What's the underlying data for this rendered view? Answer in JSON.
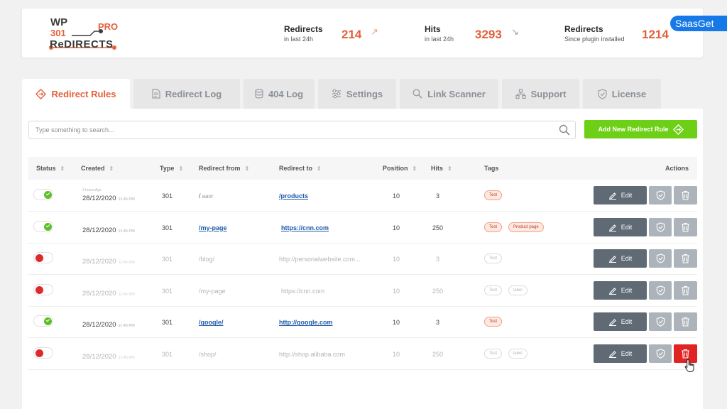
{
  "logo": {
    "wp": "WP",
    "num": "301",
    "pro": "PRO",
    "redirects": "ReDIRECTS"
  },
  "stats": [
    {
      "title": "Redirects",
      "sub": "in last 24h",
      "value": "214",
      "arrow": "↗"
    },
    {
      "title": "Hits",
      "sub": "in last 24h",
      "value": "3293",
      "arrow": "↘"
    },
    {
      "title": "Redirects",
      "sub": "Since plugin installed",
      "value": "1214",
      "arrow": ""
    }
  ],
  "badge": "SaasGet",
  "tabs": [
    {
      "label": "Redirect Rules",
      "icon": "redirect-icon"
    },
    {
      "label": "Redirect Log",
      "icon": "document-icon"
    },
    {
      "label": "404 Log",
      "icon": "database-icon"
    },
    {
      "label": "Settings",
      "icon": "sliders-icon"
    },
    {
      "label": "Link Scanner",
      "icon": "search-icon"
    },
    {
      "label": "Support",
      "icon": "support-icon"
    },
    {
      "label": "License",
      "icon": "shield-icon"
    }
  ],
  "search": {
    "placeholder": "Type something to search..."
  },
  "add_button": "Add New Redirect Rule",
  "columns": [
    "Status",
    "Created",
    "Type",
    "Redirect from",
    "Redirect to",
    "Position",
    "Hits",
    "Tags",
    "Actions"
  ],
  "rows": [
    {
      "status": "on",
      "ago": "2 hours Ago",
      "date": "28/12/2020",
      "time": "11:45 PM",
      "type": "301",
      "from": "/",
      "from_extra": "aaor",
      "to": "/products",
      "position": "10",
      "hits": "3",
      "tags": [
        "Test"
      ]
    },
    {
      "status": "on",
      "ago": "",
      "date": "28/12/2020",
      "time": "11:45 PM",
      "type": "301",
      "from": "/my-page",
      "from_extra": "",
      "to": "https://cnn.com",
      "position": "10",
      "hits": "250",
      "tags": [
        "Test",
        "Product page"
      ]
    },
    {
      "status": "off",
      "ago": "",
      "date": "28/12/2020",
      "time": "11:45 PM",
      "type": "301",
      "from": "/blog/",
      "from_extra": "",
      "to": "http://personalwebsite.com...",
      "position": "10",
      "hits": "3",
      "tags": [
        "Test"
      ]
    },
    {
      "status": "off",
      "ago": "",
      "date": "28/12/2020",
      "time": "11:45 PM",
      "type": "301",
      "from": "/my-page",
      "from_extra": "",
      "to": "https://cnn.com",
      "position": "10",
      "hits": "250",
      "tags": [
        "Test",
        "label"
      ]
    },
    {
      "status": "on",
      "ago": "",
      "date": "28/12/2020",
      "time": "11:45 PM",
      "type": "301",
      "from": "/google/",
      "from_extra": "",
      "to": "http://google.com",
      "position": "10",
      "hits": "3",
      "tags": [
        "Test"
      ]
    },
    {
      "status": "off",
      "ago": "",
      "date": "28/12/2020",
      "time": "11:45 PM",
      "type": "301",
      "from": "/shop/",
      "from_extra": "",
      "to": "http://shop.alibaba.com",
      "position": "10",
      "hits": "250",
      "tags": [
        "Test",
        "label"
      ]
    }
  ],
  "edit_label": "Edit",
  "colors": {
    "accent": "#e4603a",
    "green": "#6ed016",
    "danger": "#e02424",
    "link": "#1d5aa8"
  }
}
